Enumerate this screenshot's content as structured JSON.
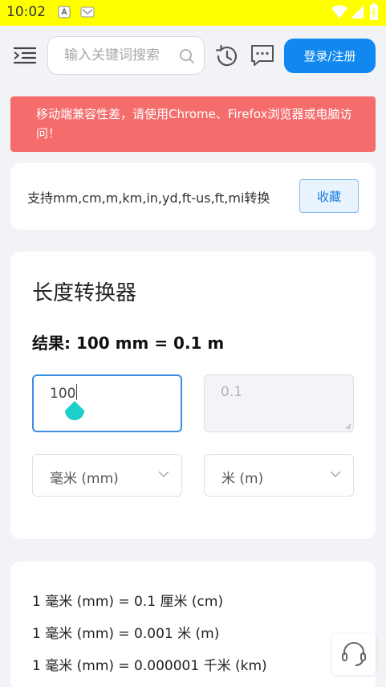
{
  "status_bar": {
    "time": "10:02"
  },
  "header": {
    "search_placeholder": "输入关键词搜索",
    "login_label": "登录/注册"
  },
  "alert": {
    "message": "移动端兼容性差，请使用Chrome、Firefox浏览器或电脑访问！"
  },
  "info": {
    "support_text": "支持mm,cm,m,km,in,yd,ft-us,ft,mi转换",
    "favorite_label": "收藏"
  },
  "converter": {
    "title": "长度转换器",
    "result": "结果: 100 mm = 0.1 m",
    "input_value": "100",
    "output_value": "0.1",
    "from_unit": "毫米 (mm)",
    "to_unit": "米 (m)"
  },
  "conversions": [
    "1 毫米 (mm) = 0.1 厘米 (cm)",
    "1 毫米 (mm) = 0.001 米 (m)",
    "1 毫米 (mm) = 0.000001 千米 (km)"
  ],
  "colors": {
    "status_bar": "#ffff00",
    "accent": "#1088f0",
    "alert": "#f56c6c",
    "cursor_handle": "#1ccfc9"
  }
}
